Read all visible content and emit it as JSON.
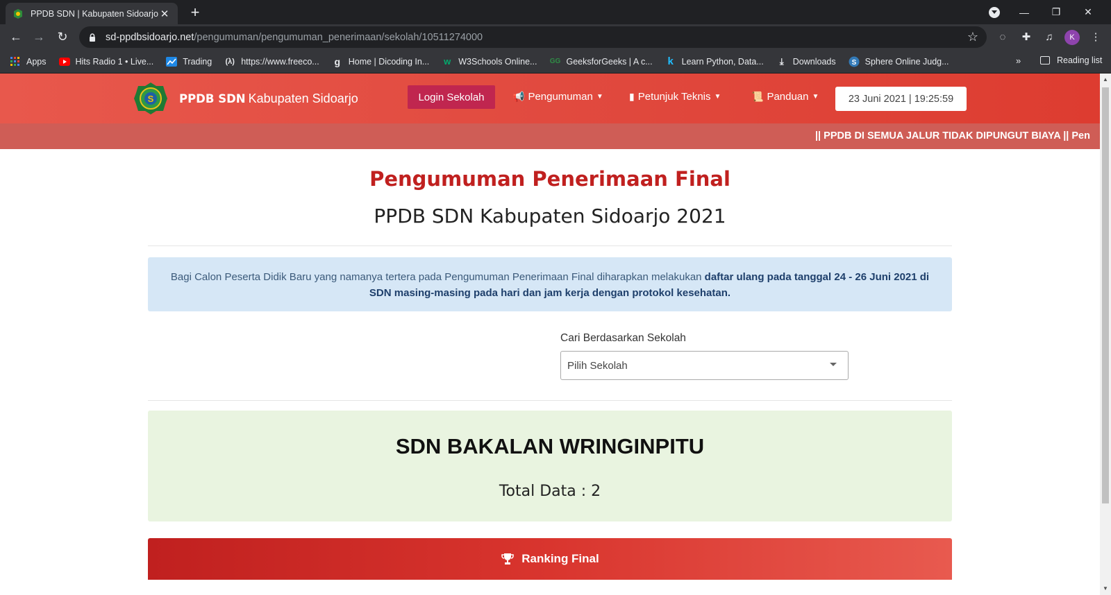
{
  "browser": {
    "tab_title": "PPDB SDN | Kabupaten Sidoarjo",
    "url_host": "sd-ppdbsidoarjo.net",
    "url_path": "/pengumuman/pengumuman_penerimaan/sekolah/10511274000",
    "profile_initial": "K",
    "bookmarks": [
      {
        "label": "Apps",
        "icon": "apps-grid-icon"
      },
      {
        "label": "Hits Radio 1 • Live...",
        "icon": "youtube-icon"
      },
      {
        "label": "Trading",
        "icon": "trading-icon"
      },
      {
        "label": "https://www.freeco...",
        "icon": "freecodecamp-icon"
      },
      {
        "label": "Home | Dicoding In...",
        "icon": "dicoding-icon"
      },
      {
        "label": "W3Schools Online...",
        "icon": "w3schools-icon"
      },
      {
        "label": "GeeksforGeeks | A c...",
        "icon": "geeksforgeeks-icon"
      },
      {
        "label": "Learn Python, Data...",
        "icon": "kaggle-icon"
      },
      {
        "label": "Downloads",
        "icon": "download-icon"
      },
      {
        "label": "Sphere Online Judg...",
        "icon": "spoj-icon"
      }
    ],
    "more_label": "»",
    "reading_list": "Reading list"
  },
  "header": {
    "brand_bold": "PPDB SDN",
    "brand_rest": "Kabupaten Sidoarjo",
    "login_label": "Login Sekolah",
    "menu": [
      {
        "label": "Pengumuman",
        "icon": "bullhorn-icon"
      },
      {
        "label": "Petunjuk Teknis",
        "icon": "book-icon"
      },
      {
        "label": "Panduan",
        "icon": "scroll-icon"
      }
    ],
    "datetime": "23 Juni 2021 | 19:25:59",
    "ticker": "|| PPDB DI SEMUA JALUR TIDAK DIPUNGUT BIAYA || Pen"
  },
  "main": {
    "title": "Pengumuman Penerimaan Final",
    "subtitle": "PPDB SDN Kabupaten Sidoarjo 2021",
    "info_normal": "Bagi Calon Peserta Didik Baru yang namanya tertera pada Pengumuman Penerimaan Final diharapkan melakukan ",
    "info_bold": "daftar ulang pada tanggal 24 - 26 Juni 2021 di SDN masing-masing pada hari dan jam kerja dengan protokol kesehatan.",
    "search_label": "Cari Berdasarkan Sekolah",
    "select_value": "Pilih Sekolah",
    "school_name": "SDN BAKALAN WRINGINPITU",
    "total": "Total Data : 2",
    "ranking_label": "Ranking Final"
  },
  "colors": {
    "header_red": "#e14a3f",
    "title_red": "#c0201f",
    "login_btn": "#c0264f",
    "info_bg": "#d6e7f6",
    "school_bg": "#e9f4e0"
  }
}
